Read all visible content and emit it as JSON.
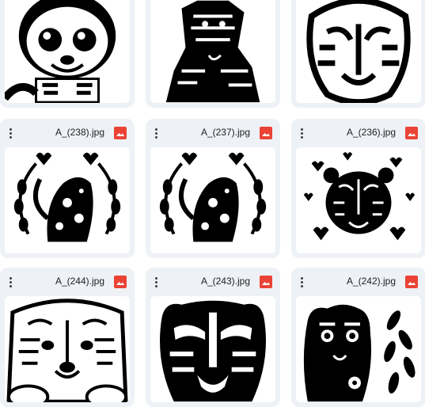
{
  "grid": {
    "rows": [
      {
        "cards": [
          {
            "filename": "",
            "thumbnail": "cartoon-tiger-cub"
          },
          {
            "filename": "",
            "thumbnail": "sitting-tiger-cub"
          },
          {
            "filename": "",
            "thumbnail": "tiger-face-line-art"
          }
        ]
      },
      {
        "cards": [
          {
            "filename": "A_(238).jpg",
            "thumbnail": "tiger-floral-wreath"
          },
          {
            "filename": "A_(237).jpg",
            "thumbnail": "tiger-floral-wreath"
          },
          {
            "filename": "A_(236).jpg",
            "thumbnail": "tiger-face-hearts"
          }
        ]
      },
      {
        "cards": [
          {
            "filename": "A_(244).jpg",
            "thumbnail": "realistic-tiger-face"
          },
          {
            "filename": "A_(243).jpg",
            "thumbnail": "tiger-head-stencil"
          },
          {
            "filename": "A_(242).jpg",
            "thumbnail": "tiger-cub-in-leaves"
          }
        ]
      }
    ]
  },
  "colors": {
    "card_bg": "#eef1f5",
    "file_type_icon": "#ea4335",
    "text": "#202124"
  },
  "icons": {
    "more": "more-vert-icon",
    "file_type": "image-file-icon"
  }
}
